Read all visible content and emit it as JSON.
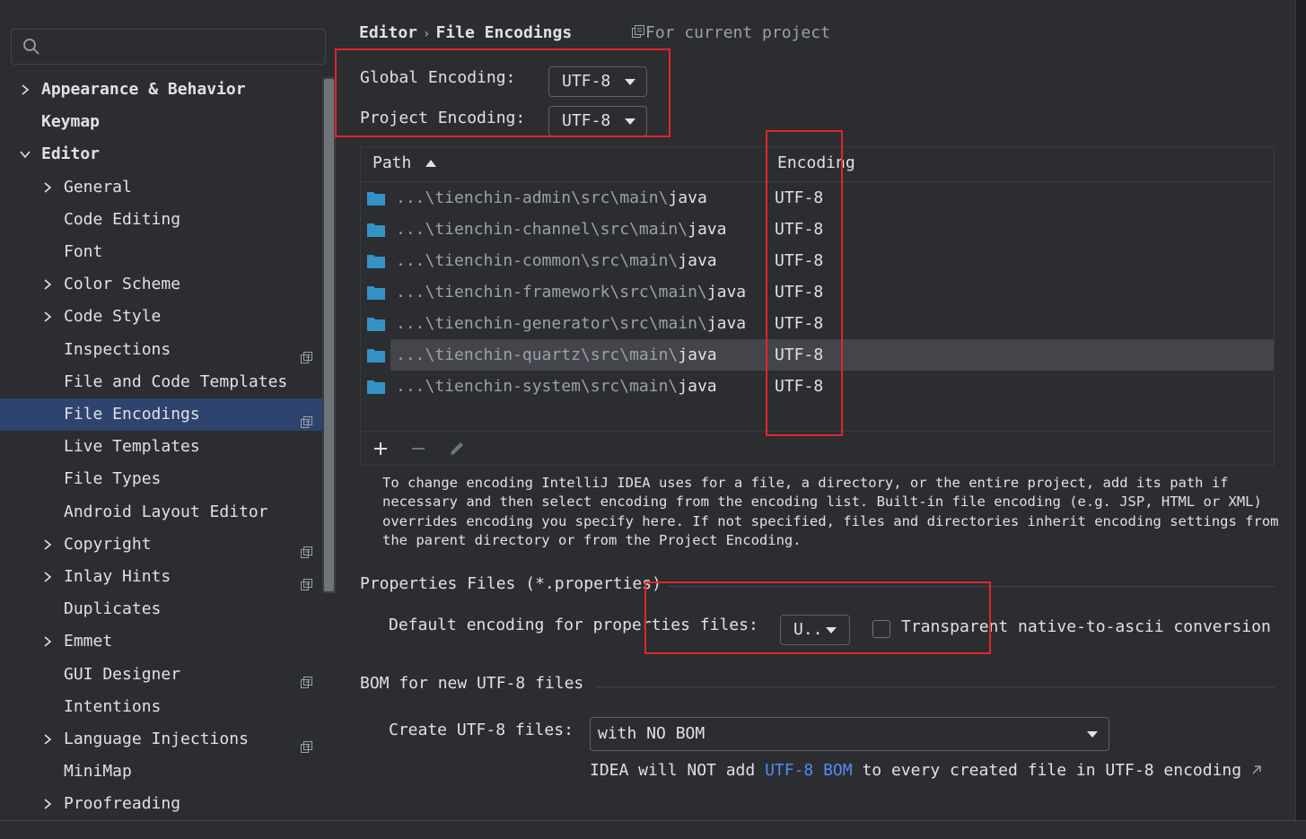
{
  "sidebar": {
    "search": {
      "placeholder": ""
    },
    "items": [
      {
        "label": "Appearance & Behavior",
        "chevron": "right",
        "bold": true
      },
      {
        "label": "Keymap",
        "chevron": "",
        "bold": true
      },
      {
        "label": "Editor",
        "chevron": "down",
        "bold": true
      },
      {
        "label": "General",
        "chevron": "right"
      },
      {
        "label": "Code Editing",
        "chevron": ""
      },
      {
        "label": "Font",
        "chevron": ""
      },
      {
        "label": "Color Scheme",
        "chevron": "right"
      },
      {
        "label": "Code Style",
        "chevron": "right"
      },
      {
        "label": "Inspections",
        "chevron": "",
        "project_icon": true
      },
      {
        "label": "File and Code Templates",
        "chevron": ""
      },
      {
        "label": "File Encodings",
        "chevron": "",
        "project_icon": true,
        "selected": true
      },
      {
        "label": "Live Templates",
        "chevron": ""
      },
      {
        "label": "File Types",
        "chevron": ""
      },
      {
        "label": "Android Layout Editor",
        "chevron": ""
      },
      {
        "label": "Copyright",
        "chevron": "right",
        "project_icon": true
      },
      {
        "label": "Inlay Hints",
        "chevron": "right",
        "project_icon": true
      },
      {
        "label": "Duplicates",
        "chevron": ""
      },
      {
        "label": "Emmet",
        "chevron": "right"
      },
      {
        "label": "GUI Designer",
        "chevron": "",
        "project_icon": true
      },
      {
        "label": "Intentions",
        "chevron": ""
      },
      {
        "label": "Language Injections",
        "chevron": "right",
        "project_icon": true
      },
      {
        "label": "MiniMap",
        "chevron": ""
      },
      {
        "label": "Proofreading",
        "chevron": "right"
      }
    ]
  },
  "breadcrumb": {
    "parent": "Editor",
    "separator": "›",
    "current": "File Encodings"
  },
  "scope_hint": "For current project",
  "global_encoding": {
    "label": "Global Encoding:",
    "value": "UTF-8"
  },
  "project_encoding": {
    "label": "Project Encoding:",
    "value": "UTF-8"
  },
  "table": {
    "columns": [
      "Path",
      "Encoding"
    ],
    "sort_icon": "sort-ascending-icon",
    "rows": [
      {
        "prefix": "...\\tienchin-admin\\src\\main\\",
        "leaf": "java",
        "encoding": "UTF-8"
      },
      {
        "prefix": "...\\tienchin-channel\\src\\main\\",
        "leaf": "java",
        "encoding": "UTF-8"
      },
      {
        "prefix": "...\\tienchin-common\\src\\main\\",
        "leaf": "java",
        "encoding": "UTF-8"
      },
      {
        "prefix": "...\\tienchin-framework\\src\\main\\",
        "leaf": "java",
        "encoding": "UTF-8"
      },
      {
        "prefix": "...\\tienchin-generator\\src\\main\\",
        "leaf": "java",
        "encoding": "UTF-8"
      },
      {
        "prefix": "...\\tienchin-quartz\\src\\main\\",
        "leaf": "java",
        "encoding": "UTF-8",
        "selected": true
      },
      {
        "prefix": "...\\tienchin-system\\src\\main\\",
        "leaf": "java",
        "encoding": "UTF-8"
      }
    ]
  },
  "help_text": "To change encoding IntelliJ IDEA uses for a file, a directory, or the entire project, add its path if\nnecessary and then select encoding from the encoding list. Built-in file encoding (e.g. JSP, HTML or XML)\noverrides encoding you specify here. If not specified, files and directories inherit encoding settings from\nthe parent directory or from the Project Encoding.",
  "properties": {
    "section_title": "Properties Files (*.properties)",
    "default_label": "Default encoding for properties files:",
    "default_value": "U..",
    "transparent_label": "Transparent native-to-ascii conversion",
    "transparent_checked": false
  },
  "bom": {
    "section_title": "BOM for new UTF-8 files",
    "create_label": "Create UTF-8 files:",
    "create_value": "with NO BOM",
    "note_before": "IDEA will NOT add ",
    "note_link": "UTF-8 BOM",
    "note_after": " to every created file in UTF-8 encoding"
  },
  "colors": {
    "background": "#2b2d30",
    "selection": "#2e436e",
    "highlight_box": "#e0262b",
    "link": "#548af7",
    "folder": "#3592c4"
  }
}
